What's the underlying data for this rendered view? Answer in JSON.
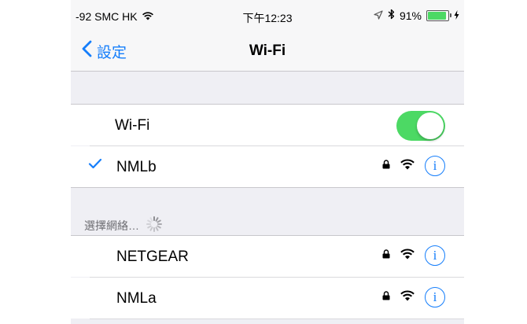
{
  "status_bar": {
    "carrier": "-92 SMC HK",
    "time": "下午12:23",
    "battery_percent": "91%",
    "battery_level": 0.91,
    "icons": [
      "wifi-signal-icon",
      "location-arrow-icon",
      "bluetooth-icon",
      "battery-icon",
      "charging-bolt-icon"
    ]
  },
  "nav": {
    "back_label": "設定",
    "title": "Wi-Fi"
  },
  "wifi_toggle": {
    "label": "Wi-Fi",
    "on": true
  },
  "connected_network": {
    "name": "NMLb",
    "secured": true,
    "icons": [
      "checkmark-icon",
      "lock-icon",
      "wifi-signal-icon",
      "info-icon"
    ]
  },
  "choose_network": {
    "header": "選擇網絡…",
    "networks": [
      {
        "name": "NETGEAR",
        "secured": true
      },
      {
        "name": "NMLa",
        "secured": true
      }
    ]
  },
  "colors": {
    "accent": "#157efb",
    "toggle_on": "#4cd964",
    "background": "#efeff4"
  }
}
